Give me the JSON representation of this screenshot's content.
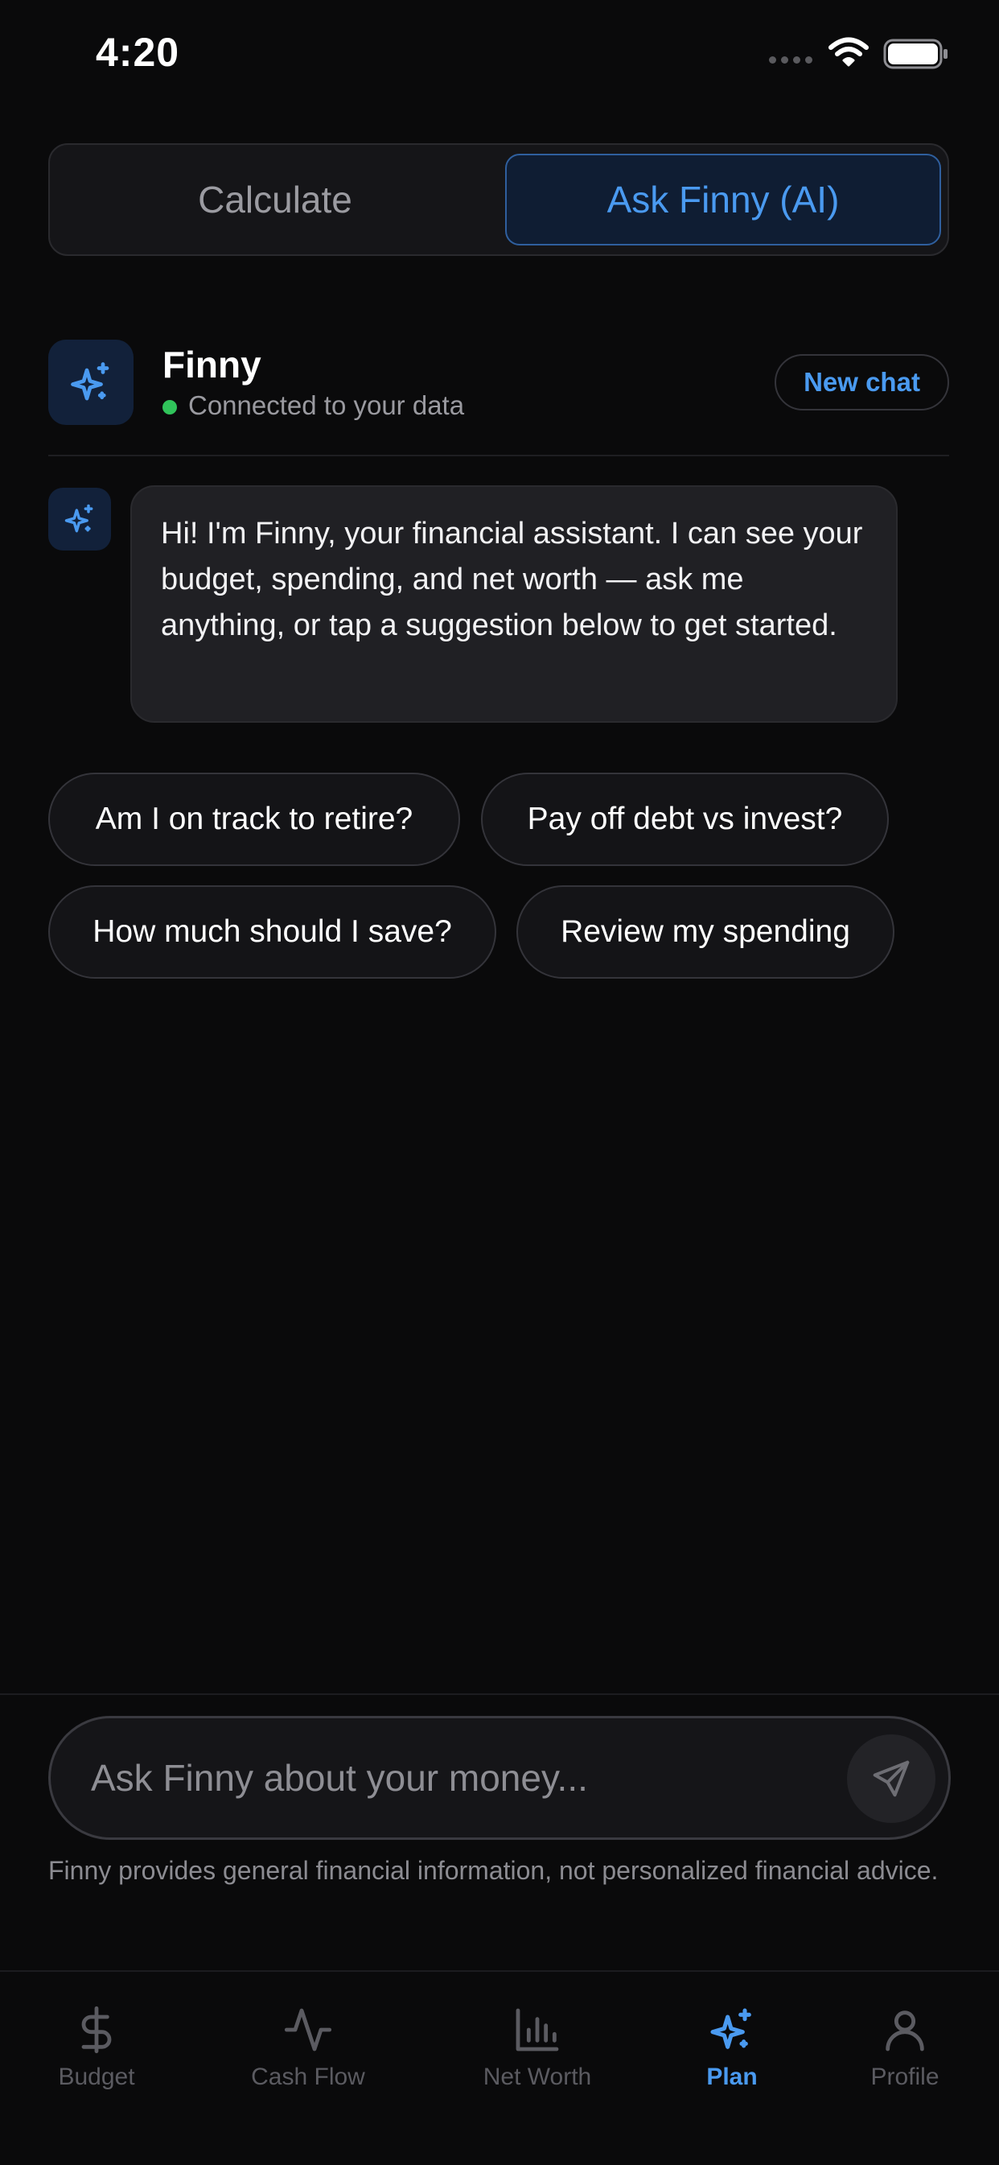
{
  "status_bar": {
    "time": "4:20"
  },
  "segmented": {
    "calculate": "Calculate",
    "ask_ai": "Ask Finny (AI)",
    "selected": "ask_ai"
  },
  "assistant": {
    "name": "Finny",
    "status": "Connected to your data",
    "status_color": "#30c35a",
    "new_chat": "New chat",
    "icon": "sparkle-icon"
  },
  "messages": [
    {
      "from": "assistant",
      "text": "Hi! I'm Finny, your financial assistant. I can see your budget, spending, and net worth — ask me anything, or tap a suggestion below to get started."
    }
  ],
  "suggestions": [
    "Am I on track to retire?",
    "Pay off debt vs invest?",
    "How much should I save?",
    "Review my spending"
  ],
  "composer": {
    "placeholder": "Ask Finny about your money...",
    "send_icon": "send-icon"
  },
  "disclaimer": "Finny provides general financial information, not personalized financial advice.",
  "tabs": [
    {
      "label": "Budget",
      "icon": "dollar-icon"
    },
    {
      "label": "Cash Flow",
      "icon": "pulse-icon"
    },
    {
      "label": "Net Worth",
      "icon": "bar-chart-icon"
    },
    {
      "label": "Plan",
      "icon": "sparkle-icon",
      "active": true
    },
    {
      "label": "Profile",
      "icon": "person-icon"
    }
  ],
  "colors": {
    "accent": "#4a9af0",
    "background": "#0a0a0b",
    "inactive": "#5b5b61"
  }
}
